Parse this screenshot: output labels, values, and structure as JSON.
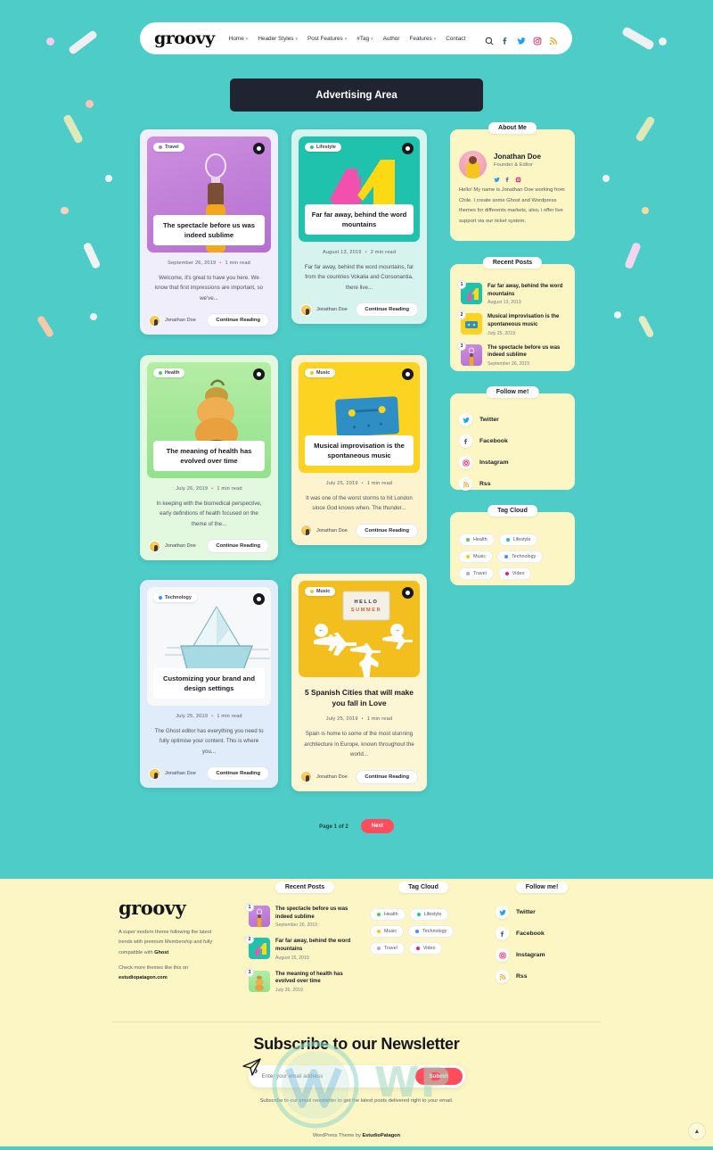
{
  "site": {
    "brand": "groovy",
    "footer_brand": "groovy"
  },
  "nav": {
    "items": [
      {
        "label": "Home",
        "caret": true
      },
      {
        "label": "Header Styles",
        "caret": true
      },
      {
        "label": "Post Features",
        "caret": true
      },
      {
        "label": "#Tag",
        "caret": true
      },
      {
        "label": "Author",
        "caret": false
      },
      {
        "label": "Features",
        "caret": true
      },
      {
        "label": "Contact",
        "caret": false
      }
    ],
    "icons": [
      "search-icon",
      "facebook-icon",
      "twitter-icon",
      "instagram-icon",
      "rss-icon"
    ]
  },
  "ad": {
    "label": "Advertising Area"
  },
  "posts": [
    {
      "tag": "Travel",
      "tag_color": "#b07ae0",
      "title": "The spectacle before us was indeed sublime",
      "date": "September 26, 2019",
      "read": "1 min read",
      "excerpt": "Welcome, it's great to have you here. We know that first impressions are important, so we've...",
      "author": "Jonathan Doe",
      "cta": "Continue Reading",
      "card_bg": "#f0eefa",
      "media_bg": "#c07fd8"
    },
    {
      "tag": "Lifestyle",
      "tag_color": "#24c2a8",
      "title": "Far far away, behind the word mountains",
      "date": "August 13, 2019",
      "read": "2 min read",
      "excerpt": "Far far away, behind the word mountains, far from the countries Vokalia and Consonantia, there live...",
      "author": "Jonathan Doe",
      "cta": "Continue Reading",
      "card_bg": "#d6f3ee",
      "media_bg": "#1fc3ad"
    },
    {
      "tag": "Health",
      "tag_color": "#55c95e",
      "title": "The meaning of health has evolved over time",
      "date": "July 26, 2019",
      "read": "1 min read",
      "excerpt": "In keeping with the biomedical perspective, early definitions of health focused on the theme of the...",
      "author": "Jonathan Doe",
      "cta": "Continue Reading",
      "card_bg": "#e2f8df",
      "media_bg": "#a9e99a"
    },
    {
      "tag": "Music",
      "tag_color": "#f5c518",
      "title": "Musical improvisation is the spontaneous music",
      "date": "July 25, 2019",
      "read": "1 min read",
      "excerpt": "It was one of the worst storms to hit London since God knows when. The thunder...",
      "author": "Jonathan Doe",
      "cta": "Continue Reading",
      "card_bg": "#fdf4cf",
      "media_bg": "#fbd320"
    },
    {
      "tag": "Technology",
      "tag_color": "#4a8df0",
      "title": "Customizing your brand and design settings",
      "date": "July 25, 2019",
      "read": "1 min read",
      "excerpt": "The Ghost editor has everything you need to fully optimise your content. This is where you...",
      "author": "Jonathan Doe",
      "cta": "Continue Reading",
      "card_bg": "#e1ecfb",
      "media_bg": "#f4f6f8"
    },
    {
      "tag": "Music",
      "tag_color": "#f5c518",
      "title": "5 Spanish Cities that will make you fall in Love",
      "date": "July 25, 2019",
      "read": "1 min read",
      "excerpt": "Spain is home to some of the most stunning architecture in Europe, known throughout the world...",
      "author": "Jonathan Doe",
      "cta": "Continue Reading",
      "card_bg": "#fdf6d4",
      "media_bg": "#f2bf1f",
      "slider": {
        "prev": "←",
        "next": "→",
        "sign_line1": "HELLO",
        "sign_line2": "SUMMER"
      }
    }
  ],
  "sidebar": {
    "about": {
      "title": "About Me",
      "name": "Jonathan Doe",
      "role": "Founder & Editor",
      "socials": [
        "twitter-icon",
        "facebook-icon",
        "instagram-icon"
      ],
      "text": "Hello! My name is Jonathan Doe working from Chile. I create some Ghost and Wordpress themes for differents markets, also, i offer live support via our ticket system."
    },
    "recent": {
      "title": "Recent Posts",
      "items": [
        {
          "num": "1",
          "title": "Far far away, behind the word mountains",
          "date": "August 13, 2019"
        },
        {
          "num": "2",
          "title": "Musical improvisation is the spontaneous music",
          "date": "July 25, 2019"
        },
        {
          "num": "3",
          "title": "The spectacle before us was indeed sublime",
          "date": "September 26, 2019"
        }
      ]
    },
    "follow": {
      "title": "Follow me!",
      "items": [
        {
          "label": "Twitter",
          "icon": "twitter-icon"
        },
        {
          "label": "Facebook",
          "icon": "facebook-icon"
        },
        {
          "label": "Instagram",
          "icon": "instagram-icon"
        },
        {
          "label": "Rss",
          "icon": "rss-icon"
        }
      ]
    },
    "tags": {
      "title": "Tag Cloud",
      "items": [
        {
          "label": "Health",
          "color": "#55c95e"
        },
        {
          "label": "Lifestyle",
          "color": "#24c2a8"
        },
        {
          "label": "Music",
          "color": "#f5c518"
        },
        {
          "label": "Technology",
          "color": "#4a8df0"
        },
        {
          "label": "Travel",
          "color": "#b4a6e8"
        },
        {
          "label": "Video",
          "color": "#e0208a"
        }
      ]
    }
  },
  "pagination": {
    "label": "Page 1 of 2",
    "next": "Next"
  },
  "footer": {
    "desc_prefix": "A super modern theme following the latest trends with premium Membership and fully compatible with ",
    "desc_bold": "Ghost",
    "more_prefix": "Check more themes like this on ",
    "more_bold": "estudiopatagon.com",
    "recent": {
      "title": "Recent Posts",
      "items": [
        {
          "num": "1",
          "title": "The spectacle before us was indeed sublime",
          "date": "September 26, 2019"
        },
        {
          "num": "2",
          "title": "Far far away, behind the word mountains",
          "date": "August 15, 2019"
        },
        {
          "num": "3",
          "title": "The meaning of health has evolved over time",
          "date": "July 26, 2019"
        }
      ]
    },
    "tags": {
      "title": "Tag Cloud",
      "items": [
        {
          "label": "Health",
          "color": "#55c95e"
        },
        {
          "label": "Lifestyle",
          "color": "#24c2a8"
        },
        {
          "label": "Music",
          "color": "#f5c518"
        },
        {
          "label": "Technology",
          "color": "#4a8df0"
        },
        {
          "label": "Travel",
          "color": "#b4a6e8"
        },
        {
          "label": "Video",
          "color": "#e0208a"
        }
      ]
    },
    "follow": {
      "title": "Follow me!",
      "items": [
        {
          "label": "Twitter",
          "icon": "twitter-icon"
        },
        {
          "label": "Facebook",
          "icon": "facebook-icon"
        },
        {
          "label": "Instagram",
          "icon": "instagram-icon"
        },
        {
          "label": "Rss",
          "icon": "rss-icon"
        }
      ]
    },
    "newsletter": {
      "title": "Subscribe to our Newsletter",
      "placeholder": "Enter your email address",
      "submit": "Submit",
      "note": "Subscribe to our email newsletter to get the latest posts delivered right to your email."
    },
    "credit_prefix": "WordPress Theme by ",
    "credit_bold": "EstudioPatagon",
    "to_top": "▲",
    "watermark": "WP"
  },
  "colors": {
    "page_bg": "#4ecdc8",
    "footer_bg": "#fbf6c4",
    "accent": "#ff4d5e",
    "dark": "#1f2430"
  }
}
